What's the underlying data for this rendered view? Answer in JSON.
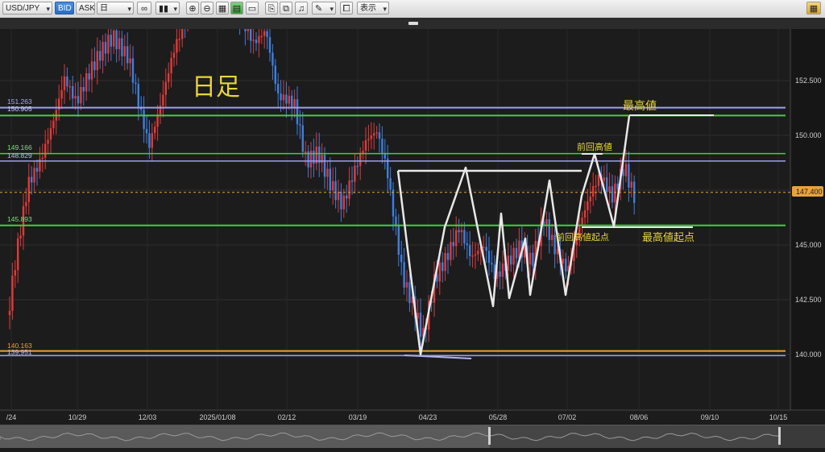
{
  "toolbar": {
    "symbol": "USD/JPY",
    "bid_label": "BID",
    "ask_label": "ASK",
    "period": "日",
    "display_label": "表示"
  },
  "chart": {
    "title_annotation": "日足",
    "x_ticks": [
      "/24",
      "10/29",
      "12/03",
      "2025/01/08",
      "02/12",
      "03/19",
      "04/23",
      "05/28",
      "07/02",
      "08/06",
      "09/10",
      "10/15"
    ],
    "y_ticks": [
      "152.500",
      "150.000",
      "147.500",
      "145.000",
      "142.500",
      "140.000"
    ],
    "level_labels": {
      "purple_high": "151.263",
      "green_high": "150.905",
      "green_mid": "149.166",
      "purple_mid": "148.829",
      "green_low": "145.893",
      "orange_low": "140.163",
      "purple_low": "139.951"
    },
    "current_price": "147.400",
    "annotations": {
      "highest": "最高値",
      "prev_high": "前回高値",
      "prev_high_start": "前回高値起点",
      "highest_start": "最高値起点"
    },
    "colors": {
      "up": "#e03a3a",
      "down": "#3d7fe0",
      "green_line": "#40d040",
      "purple_line": "#9f9ff5",
      "orange_line": "#e8a33a",
      "annotation_text": "#e6d63a"
    }
  }
}
